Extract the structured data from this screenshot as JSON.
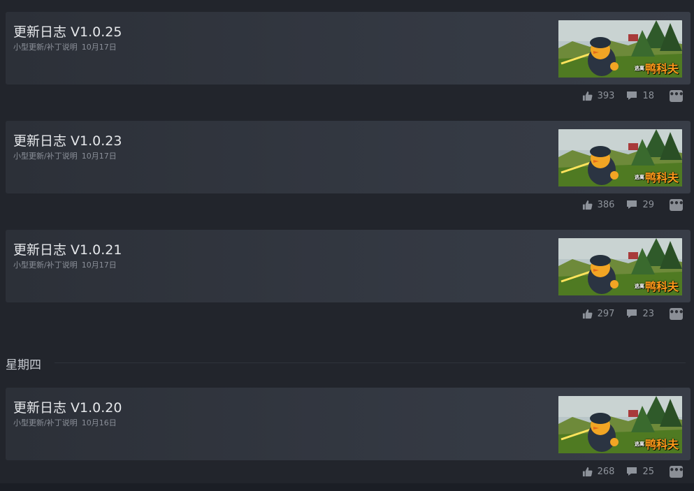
{
  "events": [
    {
      "title": "更新日志 V1.0.25",
      "category": "小型更新/补丁说明",
      "date": "10月17日",
      "likes": "393",
      "comments": "18",
      "thumb_logo_small": "逃离",
      "thumb_logo": "鸭科夫"
    },
    {
      "title": "更新日志 V1.0.23",
      "category": "小型更新/补丁说明",
      "date": "10月17日",
      "likes": "386",
      "comments": "29",
      "thumb_logo_small": "逃离",
      "thumb_logo": "鸭科夫"
    },
    {
      "title": "更新日志 V1.0.21",
      "category": "小型更新/补丁说明",
      "date": "10月17日",
      "likes": "297",
      "comments": "23",
      "thumb_logo_small": "逃离",
      "thumb_logo": "鸭科夫"
    },
    {
      "title": "更新日志 V1.0.20",
      "category": "小型更新/补丁说明",
      "date": "10月16日",
      "likes": "268",
      "comments": "25",
      "thumb_logo_small": "逃离",
      "thumb_logo": "鸭科夫"
    }
  ],
  "day_header": "星期四",
  "icons": {
    "like": "thumbs-up-icon",
    "comment": "comment-bubble-icon",
    "more": "ellipsis-icon"
  },
  "colors": {
    "background": "#1b1e25",
    "card": "#353a44",
    "accent_logo": "#ff9a1a",
    "muted_text": "#8e939b"
  }
}
